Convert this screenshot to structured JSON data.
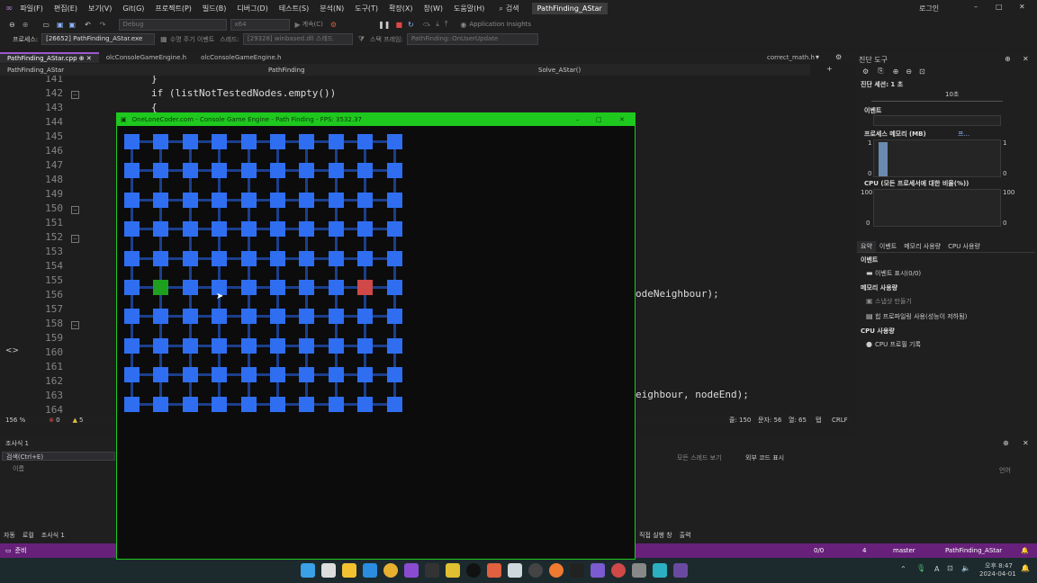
{
  "menubar": {
    "items": [
      "파일(F)",
      "편집(E)",
      "보기(V)",
      "Git(G)",
      "프로젝트(P)",
      "빌드(B)",
      "디버그(D)",
      "테스트(S)",
      "분석(N)",
      "도구(T)",
      "확장(X)",
      "창(W)",
      "도움말(H)"
    ],
    "search": "검색",
    "solution_title": "PathFinding_AStar",
    "login": "로그인"
  },
  "toolbar": {
    "config": "Debug",
    "platform": "x64",
    "continue": "계속(C)",
    "app_insights": "Application Insights"
  },
  "procbar": {
    "label": "프로세스:",
    "process": "[26652] PathFinding_AStar.exe",
    "lifecycle": "수명 주기 이벤트",
    "thread_label": "스레드:",
    "thread": "[29328] winbased.dll 스레드",
    "frame_label": "스택 프레임:",
    "frame": "PathFinding::OnUserUpdate"
  },
  "tabs": [
    "PathFinding_AStar.cpp",
    "olcConsoleGameEngine.h",
    "olcConsoleGameEngine.h"
  ],
  "right_tab": "correct_math.h",
  "navbar": {
    "project": "PathFinding_AStar",
    "class": "PathFinding",
    "method": "Solve_AStar()"
  },
  "editor": {
    "lines": [
      "141",
      "142",
      "143",
      "144",
      "145",
      "146",
      "147",
      "148",
      "149",
      "150",
      "151",
      "152",
      "153",
      "154",
      "155",
      "156",
      "157",
      "158",
      "159",
      "160",
      "161",
      "162",
      "163",
      "164"
    ],
    "code_141": "}",
    "code_142": "if (listNotTestedNodes.empty())",
    "code_143": "{",
    "code_156_tail": "odeNeighbour);",
    "code_163_tail": "eighbour, nodeEnd);"
  },
  "editor_status": {
    "zoom": "156 %",
    "errors": "0",
    "warnings": "5",
    "line": "줄: 150",
    "col": "문자: 56",
    "pos": "열: 65",
    "mode": "탭",
    "eol": "CRLF"
  },
  "diag": {
    "title": "진단 도구",
    "session": "진단 세션: 1 초",
    "tick": "10초",
    "events": "이벤트",
    "mem_title": "프로세스 메모리 (MB)",
    "mem_legend": "프...",
    "mem_max": "1",
    "mem_min": "0",
    "cpu_title": "CPU (모든 프로세서에 대한 비율(%))",
    "cpu_max": "100",
    "cpu_min": "0",
    "tabs": [
      "요약",
      "이벤트",
      "메모리 사용량",
      "CPU 사용량"
    ],
    "sec_events": "이벤트",
    "show_events": "이벤트 표시(0/0)",
    "sec_mem": "메모리 사용량",
    "snapshot": "스냅샷 만들기",
    "heap": "힙 프로파일링 사용(성능이 저하됨)",
    "sec_cpu": "CPU 사용량",
    "cpu_record": "CPU 프로필 기록"
  },
  "locals": {
    "title": "조사식 1",
    "search": "검색(Ctrl+E)",
    "col_name": "이름",
    "tabs": [
      "자동",
      "로컬",
      "조사식 1"
    ]
  },
  "bottomright": {
    "all_threads": "모든 스레드 보기",
    "external": "외부 코드 표시",
    "lang": "언어",
    "tabs": [
      "직접 실행 창",
      "출력"
    ]
  },
  "statusbar": {
    "ready": "준비",
    "arrows": "0/0",
    "edits": "4",
    "branch": "master",
    "repo": "PathFinding_AStar"
  },
  "taskbar": {
    "time": "오후 8:47",
    "date": "2024-04-01",
    "ime": "A"
  },
  "console": {
    "title": "OneLoneCoder.com - Console Game Engine - Path Finding - FPS: 3532.37"
  },
  "grid": {
    "cols": 10,
    "rows": 10,
    "start": [
      1,
      5
    ],
    "end": [
      8,
      5
    ]
  },
  "colors": {
    "accent": "#68217a",
    "console_border": "#1ec81e",
    "node": "#2f6ef0",
    "link": "#1c3f8c",
    "start": "#1ea01e",
    "end": "#d04848"
  }
}
